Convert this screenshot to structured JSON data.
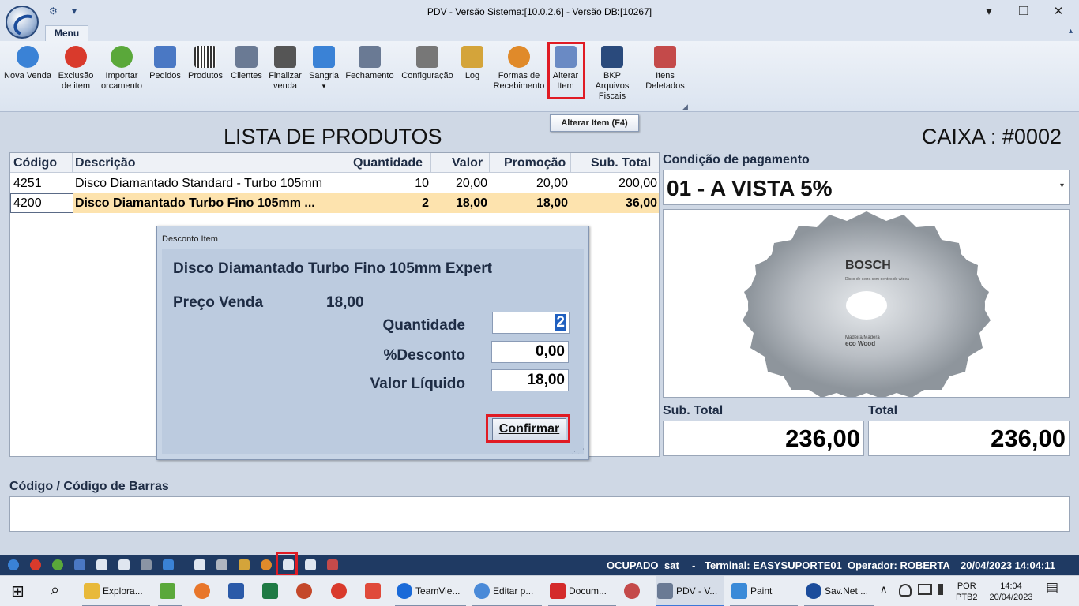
{
  "window": {
    "title": "PDV - Versão Sistema:[10.0.2.6] - Versão DB:[10267]",
    "minimize": "▾",
    "maximize": "❐",
    "close": "✕",
    "qa_icon": "⚙",
    "qa_dropdown": "▾"
  },
  "ribbon": {
    "tab_label": "Menu",
    "collapse_icon": "▴",
    "launcher": "◢",
    "buttons": [
      {
        "label": "Nova Venda",
        "icon": "plus-circle-icon",
        "color": "#3a82d6"
      },
      {
        "label": "Exclusão de item",
        "icon": "delete-circle-icon",
        "color": "#d93a2c"
      },
      {
        "label": "Importar orcamento",
        "icon": "refresh-icon",
        "color": "#5aa83a"
      },
      {
        "label": "Pedidos",
        "icon": "orders-grid-icon",
        "color": "#4a78c4"
      },
      {
        "label": "Produtos",
        "icon": "barcode-icon",
        "color": "#333333"
      },
      {
        "label": "Clientes",
        "icon": "id-card-icon",
        "color": "#6a7a94"
      },
      {
        "label": "Finalizar venda",
        "icon": "cart-icon",
        "color": "#555555"
      },
      {
        "label": "Sangria",
        "icon": "upload-icon",
        "color": "#3a82d6"
      },
      {
        "label": "Fechamento",
        "icon": "calculator-icon",
        "color": "#6a7a94"
      },
      {
        "label": "Configuração",
        "icon": "tools-icon",
        "color": "#777777"
      },
      {
        "label": "Log",
        "icon": "log-file-icon",
        "color": "#d4a43a"
      },
      {
        "label": "Formas de Recebimento",
        "icon": "coins-icon",
        "color": "#e08a2a"
      },
      {
        "label": "Alterar Item",
        "icon": "edit-document-icon",
        "color": "#6a8ac4"
      },
      {
        "label": "BKP Arquivos Fiscais",
        "icon": "floppy-icon",
        "color": "#2a4a7c"
      },
      {
        "label": "Itens Deletados",
        "icon": "deleted-items-icon",
        "color": "#c44a4a"
      }
    ],
    "sangria_arrow": "▾",
    "tooltip": "Alterar Item (F4)"
  },
  "main": {
    "list_title": "LISTA DE PRODUTOS",
    "caixa": "CAIXA : #0002",
    "grid": {
      "columns": [
        "Código",
        "Descrição",
        "Quantidade",
        "Valor",
        "Promoção",
        "Sub. Total"
      ],
      "rows": [
        {
          "codigo": "4251",
          "descricao": "Disco Diamantado Standard - Turbo 105mm",
          "quantidade": "10",
          "valor": "20,00",
          "promocao": "20,00",
          "subtotal": "200,00"
        },
        {
          "codigo": "4200",
          "descricao": "Disco Diamantado Turbo Fino 105mm ...",
          "quantidade": "2",
          "valor": "18,00",
          "promocao": "18,00",
          "subtotal": "36,00"
        }
      ]
    },
    "barcode_label": "Código / Código de Barras"
  },
  "dialog": {
    "title": "Desconto Item",
    "product": "Disco Diamantado Turbo Fino 105mm Expert",
    "preco_label": "Preço Venda",
    "preco_value": "18,00",
    "quantidade_label": "Quantidade",
    "quantidade_value": "2",
    "desconto_label": "%Desconto",
    "desconto_value": "0,00",
    "liquido_label": "Valor Líquido",
    "liquido_value": "18,00",
    "confirm_label": "Confirmar",
    "grip": "⋰⋰"
  },
  "right_panel": {
    "cond_label": "Condição de pagamento",
    "cond_value": "01 - A VISTA 5%",
    "cond_arrow": "▾",
    "brand": "BOSCH",
    "blade_sub": "Disco de serra com dentes de widea",
    "blade_sub2": "Madeira/Madera",
    "blade_sub3": "eco Wood",
    "sub_label": "Sub. Total",
    "sub_value": "236,00",
    "tot_label": "Total",
    "tot_value": "236,00"
  },
  "statusbar": {
    "status": "OCUPADO",
    "sat": "sat",
    "sep": "-",
    "terminal": "Terminal: EASYSUPORTE01",
    "operador": "Operador: ROBERTA",
    "datetime": "20/04/2023 14:04:11"
  },
  "taskbar": {
    "items": [
      {
        "label": "Explora...",
        "icon": "folder-icon",
        "color": "#e8b93a"
      },
      {
        "label": "",
        "icon": "chart-app-icon",
        "color": "#5aa83a"
      },
      {
        "label": "",
        "icon": "firefox-icon",
        "color": "#e8762a"
      },
      {
        "label": "",
        "icon": "word-icon",
        "color": "#2b5aa8"
      },
      {
        "label": "",
        "icon": "excel-icon",
        "color": "#1f7a44"
      },
      {
        "label": "",
        "icon": "powerpoint-icon",
        "color": "#c4482a"
      },
      {
        "label": "",
        "icon": "ccleaner-icon",
        "color": "#d93a2c"
      },
      {
        "label": "",
        "icon": "anydesk-icon",
        "color": "#e04a3a"
      },
      {
        "label": "TeamVie...",
        "icon": "teamviewer-icon",
        "color": "#1a6ad8"
      },
      {
        "label": "Editar p...",
        "icon": "chrome-icon",
        "color": "#4a8ad8"
      },
      {
        "label": "Docum...",
        "icon": "wps-icon",
        "color": "#d42a2a"
      },
      {
        "label": "",
        "icon": "screen-recorder-icon",
        "color": "#c44a4a"
      },
      {
        "label": "PDV - V...",
        "icon": "pdv-cart-icon",
        "color": "#6a7a94"
      },
      {
        "label": "Paint",
        "icon": "paint-icon",
        "color": "#3a8ad8"
      },
      {
        "label": "Sav.Net ...",
        "icon": "savnet-icon",
        "color": "#1b4c9b"
      }
    ],
    "start_icon": "⊞",
    "search_icon": "⌕",
    "lang1": "POR",
    "lang2": "PTB2",
    "time": "14:04",
    "date": "20/04/2023",
    "tray_up": "∧",
    "notification": "▤"
  }
}
